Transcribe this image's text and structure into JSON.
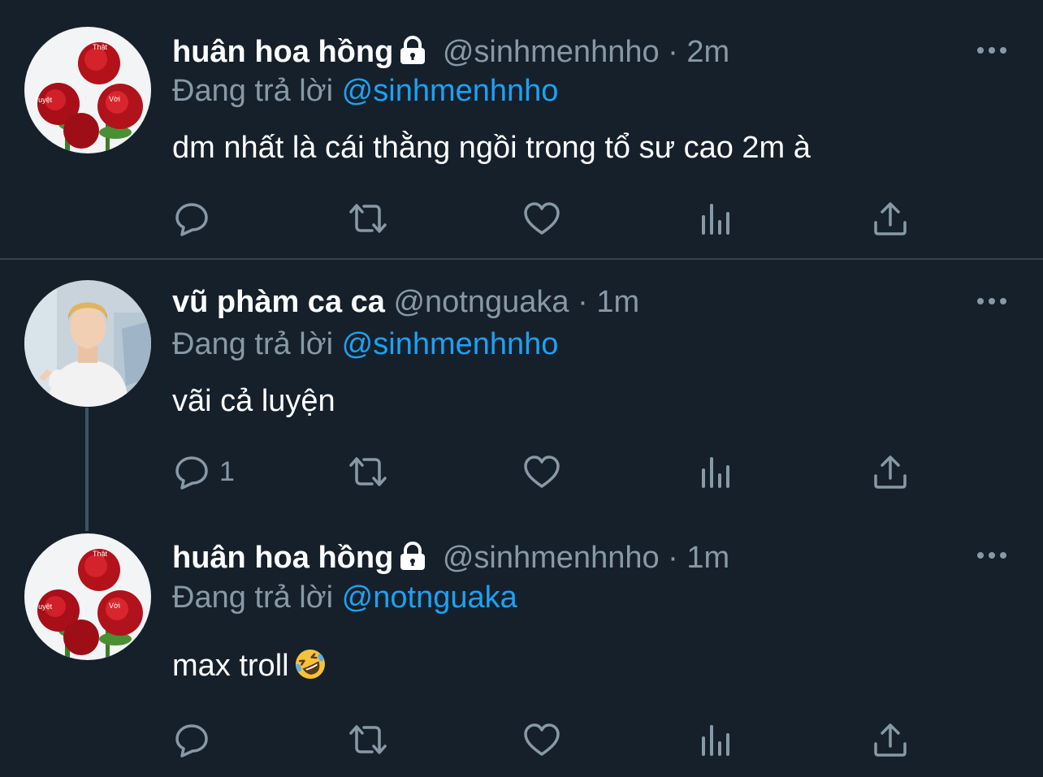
{
  "tweets": [
    {
      "name": "huân hoa hồng",
      "handle": "@sinhmenhnho",
      "sep": "·",
      "time": "2m",
      "reply_prefix": "Đang trả lời",
      "reply_to": "@sinhmenhnho",
      "text": "dm nhất là cái thằng ngồi trong tổ sư cao 2m à",
      "reply_count": "",
      "avatar_words": {
        "top": "Thật",
        "left": "Tuyệt",
        "right": "Vời"
      }
    },
    {
      "name": "vũ phàm ca ca",
      "handle": "@notnguaka",
      "sep": "·",
      "time": "1m",
      "reply_prefix": "Đang trả lời",
      "reply_to": "@sinhmenhnho",
      "text": "vãi cả luyện",
      "reply_count": "1"
    },
    {
      "name": "huân hoa hồng",
      "handle": "@sinhmenhnho",
      "sep": "·",
      "time": "1m",
      "reply_prefix": "Đang trả lời",
      "reply_to": "@notnguaka",
      "text": "max troll",
      "reply_count": "",
      "avatar_words": {
        "top": "Thật",
        "left": "Tuyệt",
        "right": "Vời"
      }
    }
  ],
  "icons": {
    "more": "more-icon",
    "reply": "reply-icon",
    "retweet": "retweet-icon",
    "like": "like-icon",
    "analytics": "analytics-icon",
    "share": "share-icon",
    "lock": "lock-icon",
    "emoji": "rolling-on-floor-laughing-emoji"
  },
  "colors": {
    "background": "#15202b",
    "secondary_text": "#8899a6",
    "link": "#1da1f2",
    "divider": "#38444d"
  }
}
